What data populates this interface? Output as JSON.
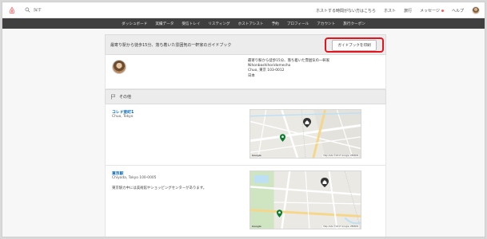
{
  "header": {
    "search_placeholder": "探す",
    "nav": [
      "ホストする時間がない方はこちら",
      "ホスト",
      "旅行",
      "メッセージ",
      "ヘルプ"
    ]
  },
  "subnav": [
    "ダッシュボード",
    "実績データ",
    "受信トレイ",
    "リスティング",
    "ホストアシスト",
    "予約",
    "プロフィール",
    "アカウント",
    "旅行クーポン"
  ],
  "guidebook": {
    "title": "最寄り駅から徒歩15分、落ち着いた雰囲気の一軒家のガイドブック",
    "print_button": "ガイドブックを印刷"
  },
  "host_address": {
    "line1": "最寄り駅から徒歩15分、落ち着いた雰囲気の一軒家",
    "line2": "Nihonbashihoridomecho",
    "line3": "Chuo, 東京 103-0012",
    "line4": "日本"
  },
  "section": {
    "title": "その他"
  },
  "places": [
    {
      "name": "コレド室町1",
      "location": "Chuo, Tokyo",
      "description": "",
      "map_credit": "Map data ©2017 Google, ZENRIN"
    },
    {
      "name": "東京駅",
      "location": "Chiyoda, Tokyo 100-0005",
      "description": "東京駅カ中には美術館やショッピングセンターがあります。",
      "map_credit": "Map data ©2017 Google, ZENRIN"
    }
  ],
  "colors": {
    "brand": "#ff5a5f",
    "highlight": "#e3141d",
    "link": "#0066b3"
  }
}
